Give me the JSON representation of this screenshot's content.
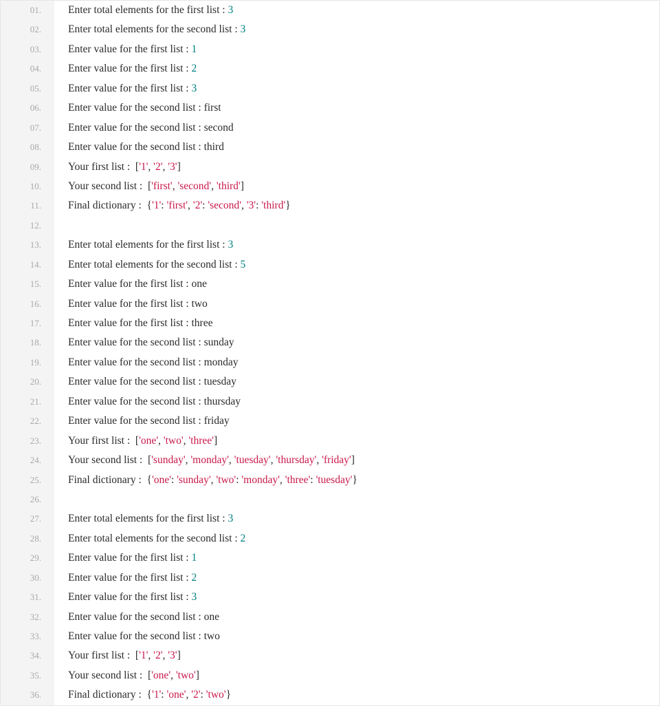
{
  "lines": [
    {
      "num": "01.",
      "tokens": [
        {
          "t": "Enter total elements for the first list : ",
          "c": "plain"
        },
        {
          "t": "3",
          "c": "num"
        }
      ]
    },
    {
      "num": "02.",
      "tokens": [
        {
          "t": "Enter total elements for the second list : ",
          "c": "plain"
        },
        {
          "t": "3",
          "c": "num"
        }
      ]
    },
    {
      "num": "03.",
      "tokens": [
        {
          "t": "Enter value for the first list : ",
          "c": "plain"
        },
        {
          "t": "1",
          "c": "num"
        }
      ]
    },
    {
      "num": "04.",
      "tokens": [
        {
          "t": "Enter value for the first list : ",
          "c": "plain"
        },
        {
          "t": "2",
          "c": "num"
        }
      ]
    },
    {
      "num": "05.",
      "tokens": [
        {
          "t": "Enter value for the first list : ",
          "c": "plain"
        },
        {
          "t": "3",
          "c": "num"
        }
      ]
    },
    {
      "num": "06.",
      "tokens": [
        {
          "t": "Enter value for the second list : first",
          "c": "plain"
        }
      ]
    },
    {
      "num": "07.",
      "tokens": [
        {
          "t": "Enter value for the second list : second",
          "c": "plain"
        }
      ]
    },
    {
      "num": "08.",
      "tokens": [
        {
          "t": "Enter value for the second list : third",
          "c": "plain"
        }
      ]
    },
    {
      "num": "09.",
      "tokens": [
        {
          "t": "Your first list :  [",
          "c": "plain"
        },
        {
          "t": "'1'",
          "c": "str"
        },
        {
          "t": ", ",
          "c": "plain"
        },
        {
          "t": "'2'",
          "c": "str"
        },
        {
          "t": ", ",
          "c": "plain"
        },
        {
          "t": "'3'",
          "c": "str"
        },
        {
          "t": "]",
          "c": "plain"
        }
      ]
    },
    {
      "num": "10.",
      "tokens": [
        {
          "t": "Your second list :  [",
          "c": "plain"
        },
        {
          "t": "'first'",
          "c": "str"
        },
        {
          "t": ", ",
          "c": "plain"
        },
        {
          "t": "'second'",
          "c": "str"
        },
        {
          "t": ", ",
          "c": "plain"
        },
        {
          "t": "'third'",
          "c": "str"
        },
        {
          "t": "]",
          "c": "plain"
        }
      ]
    },
    {
      "num": "11.",
      "tokens": [
        {
          "t": "Final dictionary :  {",
          "c": "plain"
        },
        {
          "t": "'1'",
          "c": "str"
        },
        {
          "t": ": ",
          "c": "plain"
        },
        {
          "t": "'first'",
          "c": "str"
        },
        {
          "t": ", ",
          "c": "plain"
        },
        {
          "t": "'2'",
          "c": "str"
        },
        {
          "t": ": ",
          "c": "plain"
        },
        {
          "t": "'second'",
          "c": "str"
        },
        {
          "t": ", ",
          "c": "plain"
        },
        {
          "t": "'3'",
          "c": "str"
        },
        {
          "t": ": ",
          "c": "plain"
        },
        {
          "t": "'third'",
          "c": "str"
        },
        {
          "t": "}",
          "c": "plain"
        }
      ]
    },
    {
      "num": "12.",
      "tokens": [
        {
          "t": "",
          "c": "plain"
        }
      ]
    },
    {
      "num": "13.",
      "tokens": [
        {
          "t": "Enter total elements for the first list : ",
          "c": "plain"
        },
        {
          "t": "3",
          "c": "num"
        }
      ]
    },
    {
      "num": "14.",
      "tokens": [
        {
          "t": "Enter total elements for the second list : ",
          "c": "plain"
        },
        {
          "t": "5",
          "c": "num"
        }
      ]
    },
    {
      "num": "15.",
      "tokens": [
        {
          "t": "Enter value for the first list : one",
          "c": "plain"
        }
      ]
    },
    {
      "num": "16.",
      "tokens": [
        {
          "t": "Enter value for the first list : two",
          "c": "plain"
        }
      ]
    },
    {
      "num": "17.",
      "tokens": [
        {
          "t": "Enter value for the first list : three",
          "c": "plain"
        }
      ]
    },
    {
      "num": "18.",
      "tokens": [
        {
          "t": "Enter value for the second list : sunday",
          "c": "plain"
        }
      ]
    },
    {
      "num": "19.",
      "tokens": [
        {
          "t": "Enter value for the second list : monday",
          "c": "plain"
        }
      ]
    },
    {
      "num": "20.",
      "tokens": [
        {
          "t": "Enter value for the second list : tuesday",
          "c": "plain"
        }
      ]
    },
    {
      "num": "21.",
      "tokens": [
        {
          "t": "Enter value for the second list : thursday",
          "c": "plain"
        }
      ]
    },
    {
      "num": "22.",
      "tokens": [
        {
          "t": "Enter value for the second list : friday",
          "c": "plain"
        }
      ]
    },
    {
      "num": "23.",
      "tokens": [
        {
          "t": "Your first list :  [",
          "c": "plain"
        },
        {
          "t": "'one'",
          "c": "str"
        },
        {
          "t": ", ",
          "c": "plain"
        },
        {
          "t": "'two'",
          "c": "str"
        },
        {
          "t": ", ",
          "c": "plain"
        },
        {
          "t": "'three'",
          "c": "str"
        },
        {
          "t": "]",
          "c": "plain"
        }
      ]
    },
    {
      "num": "24.",
      "tokens": [
        {
          "t": "Your second list :  [",
          "c": "plain"
        },
        {
          "t": "'sunday'",
          "c": "str"
        },
        {
          "t": ", ",
          "c": "plain"
        },
        {
          "t": "'monday'",
          "c": "str"
        },
        {
          "t": ", ",
          "c": "plain"
        },
        {
          "t": "'tuesday'",
          "c": "str"
        },
        {
          "t": ", ",
          "c": "plain"
        },
        {
          "t": "'thursday'",
          "c": "str"
        },
        {
          "t": ", ",
          "c": "plain"
        },
        {
          "t": "'friday'",
          "c": "str"
        },
        {
          "t": "]",
          "c": "plain"
        }
      ]
    },
    {
      "num": "25.",
      "tokens": [
        {
          "t": "Final dictionary :  {",
          "c": "plain"
        },
        {
          "t": "'one'",
          "c": "str"
        },
        {
          "t": ": ",
          "c": "plain"
        },
        {
          "t": "'sunday'",
          "c": "str"
        },
        {
          "t": ", ",
          "c": "plain"
        },
        {
          "t": "'two'",
          "c": "str"
        },
        {
          "t": ": ",
          "c": "plain"
        },
        {
          "t": "'monday'",
          "c": "str"
        },
        {
          "t": ", ",
          "c": "plain"
        },
        {
          "t": "'three'",
          "c": "str"
        },
        {
          "t": ": ",
          "c": "plain"
        },
        {
          "t": "'tuesday'",
          "c": "str"
        },
        {
          "t": "}",
          "c": "plain"
        }
      ]
    },
    {
      "num": "26.",
      "tokens": [
        {
          "t": "",
          "c": "plain"
        }
      ]
    },
    {
      "num": "27.",
      "tokens": [
        {
          "t": "Enter total elements for the first list : ",
          "c": "plain"
        },
        {
          "t": "3",
          "c": "num"
        }
      ]
    },
    {
      "num": "28.",
      "tokens": [
        {
          "t": "Enter total elements for the second list : ",
          "c": "plain"
        },
        {
          "t": "2",
          "c": "num"
        }
      ]
    },
    {
      "num": "29.",
      "tokens": [
        {
          "t": "Enter value for the first list : ",
          "c": "plain"
        },
        {
          "t": "1",
          "c": "num"
        }
      ]
    },
    {
      "num": "30.",
      "tokens": [
        {
          "t": "Enter value for the first list : ",
          "c": "plain"
        },
        {
          "t": "2",
          "c": "num"
        }
      ]
    },
    {
      "num": "31.",
      "tokens": [
        {
          "t": "Enter value for the first list : ",
          "c": "plain"
        },
        {
          "t": "3",
          "c": "num"
        }
      ]
    },
    {
      "num": "32.",
      "tokens": [
        {
          "t": "Enter value for the second list : one",
          "c": "plain"
        }
      ]
    },
    {
      "num": "33.",
      "tokens": [
        {
          "t": "Enter value for the second list : two",
          "c": "plain"
        }
      ]
    },
    {
      "num": "34.",
      "tokens": [
        {
          "t": "Your first list :  [",
          "c": "plain"
        },
        {
          "t": "'1'",
          "c": "str"
        },
        {
          "t": ", ",
          "c": "plain"
        },
        {
          "t": "'2'",
          "c": "str"
        },
        {
          "t": ", ",
          "c": "plain"
        },
        {
          "t": "'3'",
          "c": "str"
        },
        {
          "t": "]",
          "c": "plain"
        }
      ]
    },
    {
      "num": "35.",
      "tokens": [
        {
          "t": "Your second list :  [",
          "c": "plain"
        },
        {
          "t": "'one'",
          "c": "str"
        },
        {
          "t": ", ",
          "c": "plain"
        },
        {
          "t": "'two'",
          "c": "str"
        },
        {
          "t": "]",
          "c": "plain"
        }
      ]
    },
    {
      "num": "36.",
      "tokens": [
        {
          "t": "Final dictionary :  {",
          "c": "plain"
        },
        {
          "t": "'1'",
          "c": "str"
        },
        {
          "t": ": ",
          "c": "plain"
        },
        {
          "t": "'one'",
          "c": "str"
        },
        {
          "t": ", ",
          "c": "plain"
        },
        {
          "t": "'2'",
          "c": "str"
        },
        {
          "t": ": ",
          "c": "plain"
        },
        {
          "t": "'two'",
          "c": "str"
        },
        {
          "t": "}",
          "c": "plain"
        }
      ]
    }
  ]
}
